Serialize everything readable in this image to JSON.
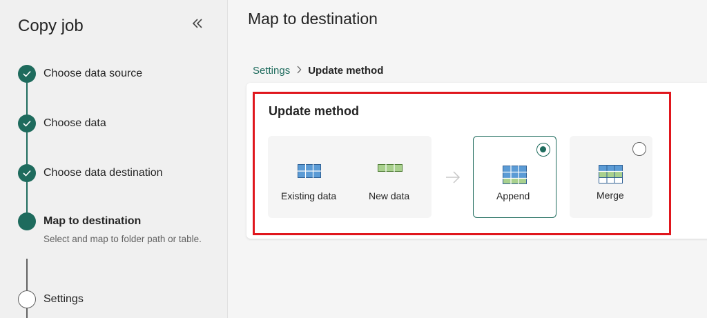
{
  "sidebar": {
    "title": "Copy job",
    "collapse_icon": "double-chevron-left-icon",
    "steps": [
      {
        "label": "Choose data source",
        "status": "done"
      },
      {
        "label": "Choose data",
        "status": "done"
      },
      {
        "label": "Choose data destination",
        "status": "done"
      },
      {
        "label": "Map to destination",
        "status": "current",
        "description": "Select and map to folder path or table."
      },
      {
        "label": "Settings",
        "status": "pending"
      }
    ]
  },
  "main": {
    "title": "Map to destination",
    "breadcrumb": {
      "parent": "Settings",
      "current": "Update method"
    },
    "update_method": {
      "title": "Update method",
      "existing_label": "Existing data",
      "new_label": "New data",
      "options": [
        {
          "label": "Append",
          "selected": true
        },
        {
          "label": "Merge",
          "selected": false
        }
      ]
    }
  },
  "colors": {
    "accent": "#1e6b5d",
    "highlight": "#e0161d",
    "table_blue": "#5b9bd5",
    "table_green": "#a9d18e"
  }
}
